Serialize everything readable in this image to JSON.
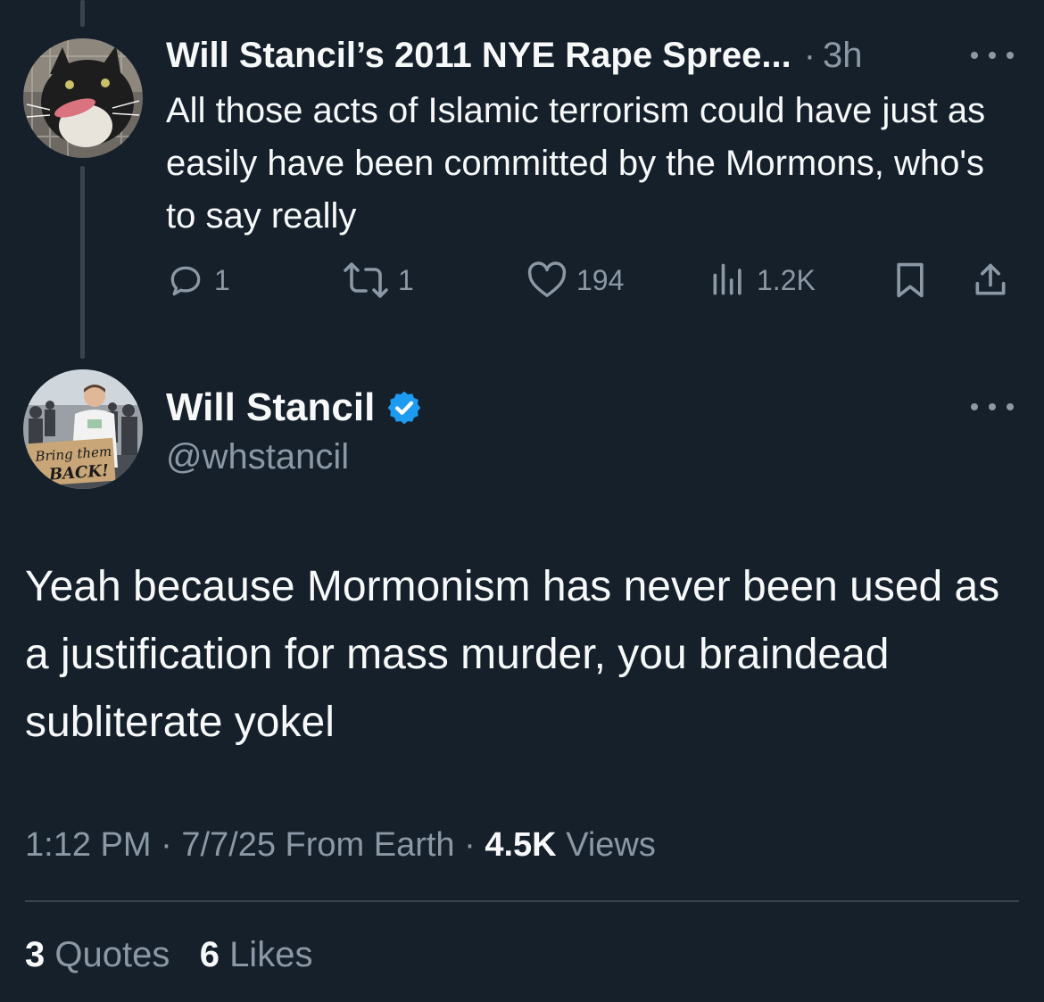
{
  "parent_tweet": {
    "display_name": "Will Stancil’s 2011 NYE Rape Spree...",
    "separator": "·",
    "time_ago": "3h",
    "text": "All those acts of Islamic terrorism could have just as easily have been committed by the Mormons, who's to say really",
    "actions": {
      "replies": "1",
      "reposts": "1",
      "likes": "194",
      "views": "1.2K"
    },
    "avatar_icon": "cat-photo-avatar",
    "more_icon": "more-options-icon"
  },
  "main_tweet": {
    "display_name": "Will Stancil",
    "handle": "@whstancil",
    "verified_color": "#1d9bf0",
    "avatar_icon": "profile-photo-avatar",
    "avatar_sign_line1": "Bring them",
    "avatar_sign_line2": "BACK!",
    "text": "Yeah because Mormonism has never been used as a justification for mass murder, you braindead subliterate yokel",
    "time": "1:12 PM",
    "date_source": "7/7/25 From Earth",
    "views_count": "4.5K",
    "views_label": "Views",
    "dot": "·",
    "quotes_count": "3",
    "quotes_label": "Quotes",
    "likes_count": "6",
    "likes_label": "Likes"
  },
  "colors": {
    "background": "#15202b",
    "primary_text": "#f7f9f9",
    "secondary_text": "#8b98a5",
    "divider": "#38444d",
    "accent_blue": "#1d9bf0"
  }
}
